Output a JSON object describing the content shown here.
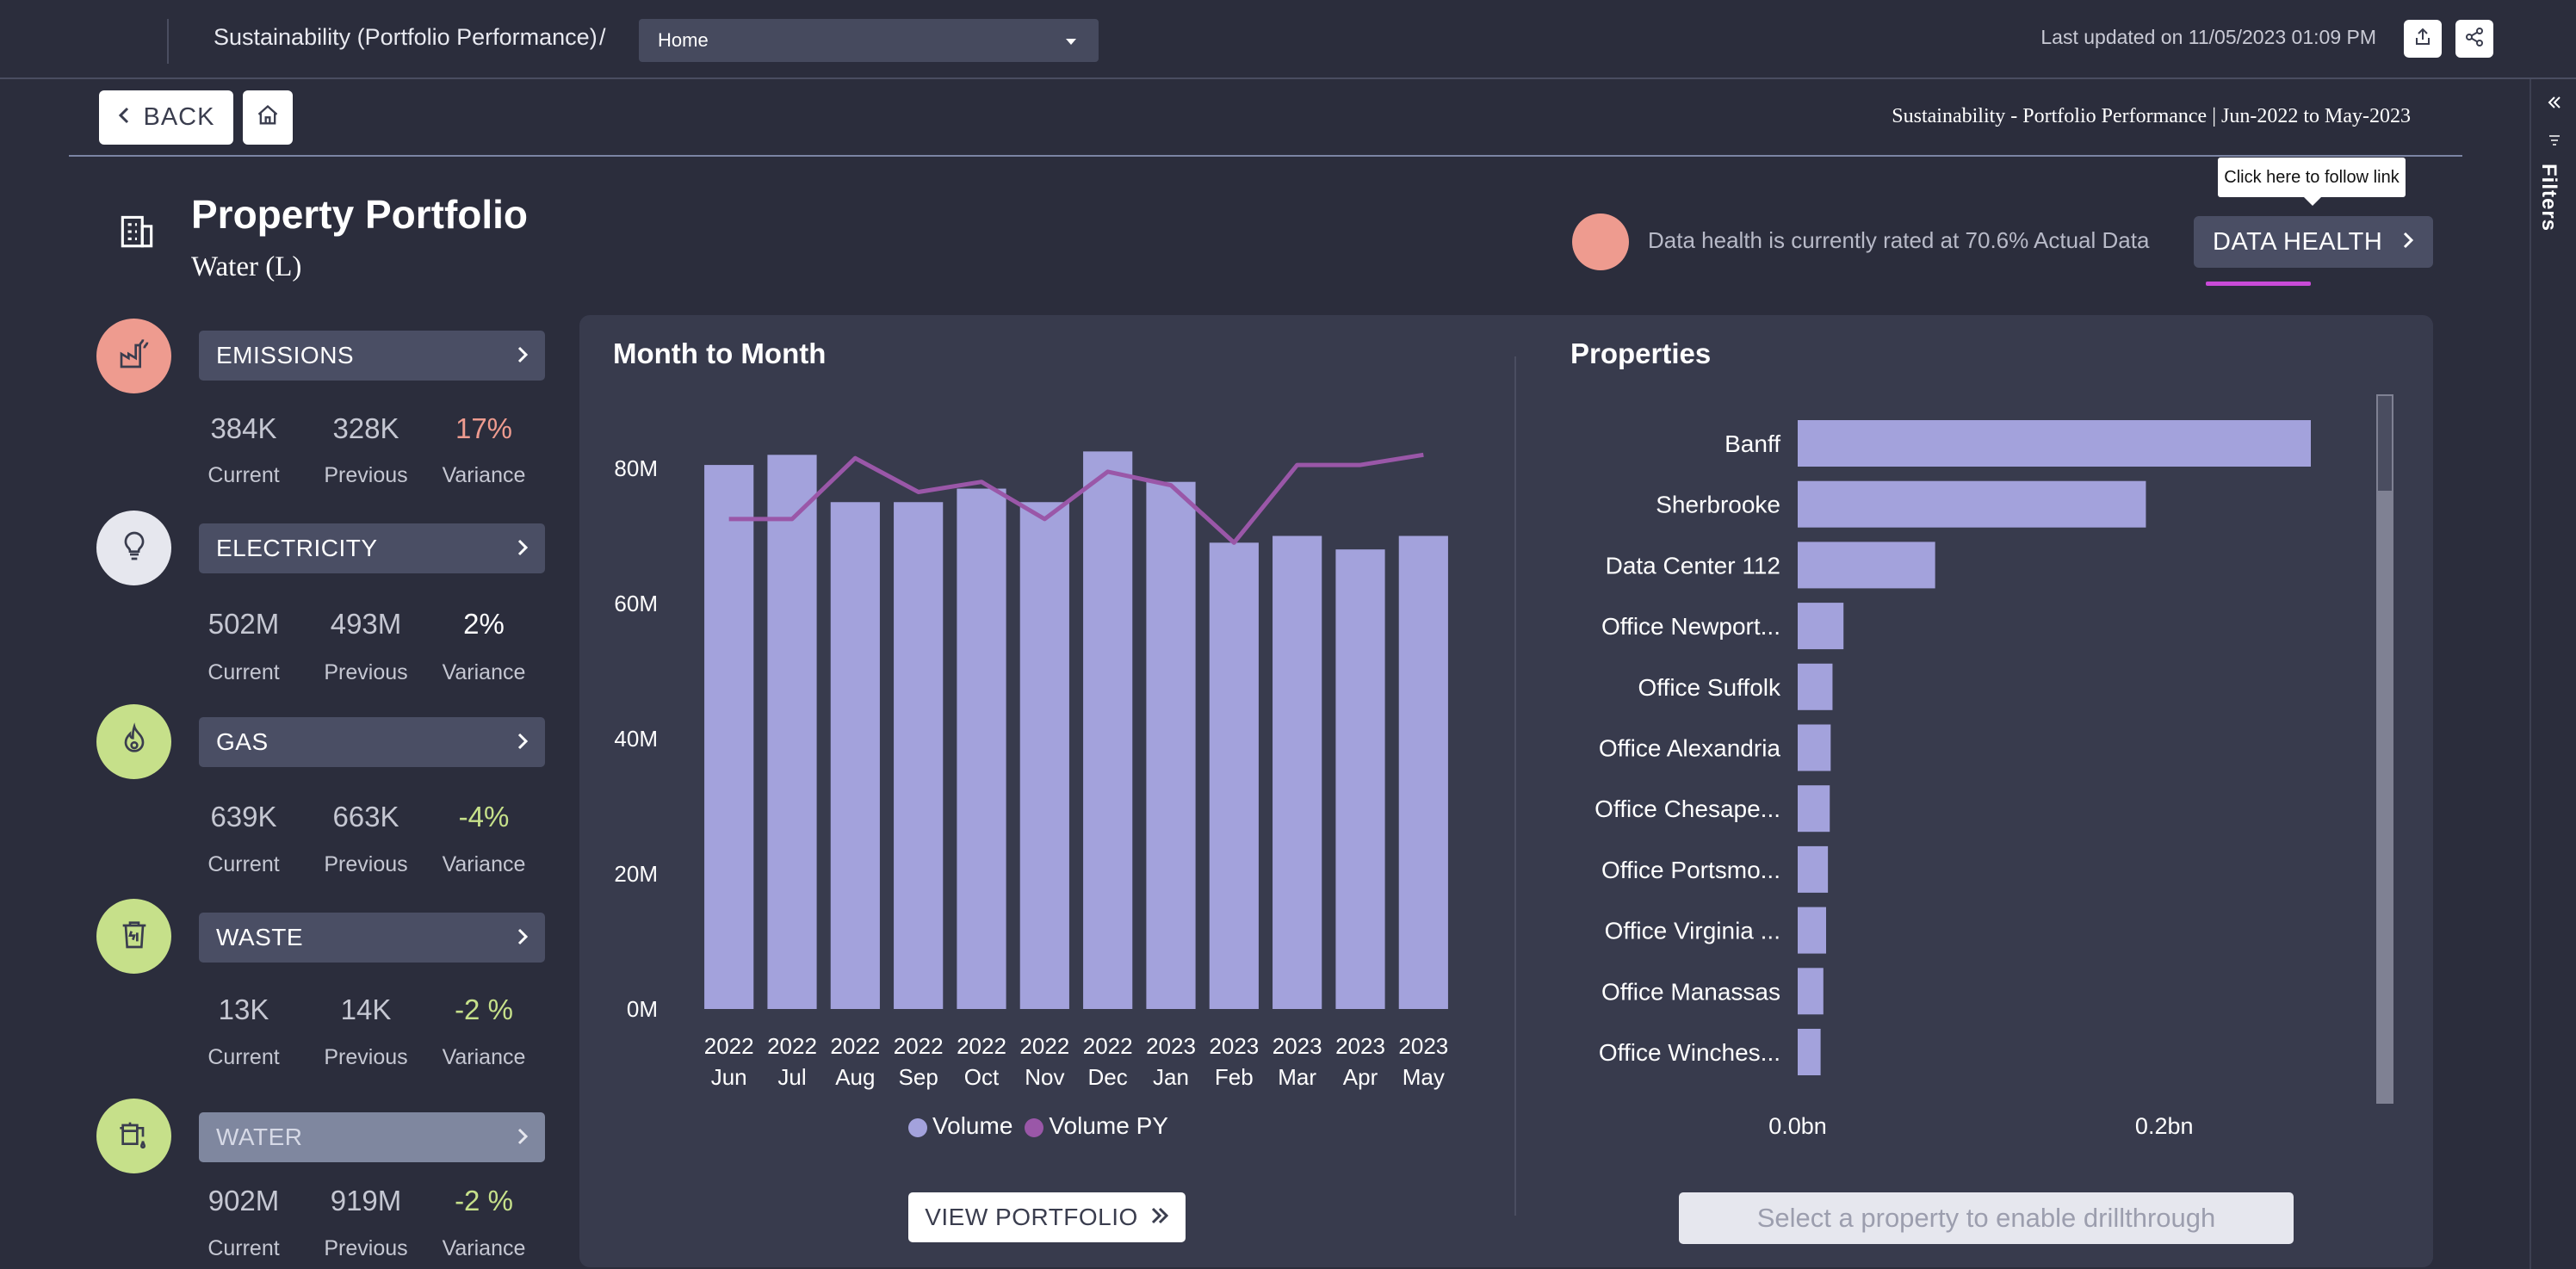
{
  "header": {
    "breadcrumb": "Sustainability (Portfolio Performance)",
    "separator": "/",
    "page_select": "Home",
    "last_updated": "Last updated on 11/05/2023 01:09 PM"
  },
  "toolbar": {
    "back_label": "BACK",
    "report_subtitle": "Sustainability - Portfolio Performance | Jun-2022 to May-2023",
    "filters_label": "Filters"
  },
  "page": {
    "title": "Property Portfolio",
    "subtitle": "Water (L)"
  },
  "data_health": {
    "text": "Data health is currently rated at 70.6% Actual Data",
    "button_label": "DATA HEALTH",
    "tooltip": "Click here to follow link",
    "dot_color": "#ee9b8f"
  },
  "metric_labels": {
    "current": "Current",
    "previous": "Previous",
    "variance": "Variance"
  },
  "metrics": [
    {
      "label": "EMISSIONS",
      "current": "384K",
      "previous": "328K",
      "variance": "17%",
      "variance_color": "#ee9b8f",
      "icon": "factory-icon",
      "circle_color": "#ee9b8f",
      "active": false
    },
    {
      "label": "ELECTRICITY",
      "current": "502M",
      "previous": "493M",
      "variance": "2%",
      "variance_color": "#ffffff",
      "icon": "lightbulb-icon",
      "circle_color": "#e6e7ee",
      "active": false
    },
    {
      "label": "GAS",
      "current": "639K",
      "previous": "663K",
      "variance": "-4%",
      "variance_color": "#c6e08a",
      "icon": "flame-icon",
      "circle_color": "#c6e08a",
      "active": false
    },
    {
      "label": "WASTE",
      "current": "13K",
      "previous": "14K",
      "variance": "-2 %",
      "variance_color": "#c6e08a",
      "icon": "recycle-bin-icon",
      "circle_color": "#c6e08a",
      "active": false
    },
    {
      "label": "WATER",
      "current": "902M",
      "previous": "919M",
      "variance": "-2 %",
      "variance_color": "#c6e08a",
      "icon": "water-tap-icon",
      "circle_color": "#c6e08a",
      "active": true
    }
  ],
  "month_chart": {
    "title": "Month to Month",
    "view_button": "VIEW PORTFOLIO"
  },
  "properties": {
    "title": "Properties",
    "drill_placeholder": "Select a property to enable drillthrough"
  },
  "chart_data": [
    {
      "type": "bar",
      "title": "Month to Month",
      "categories": [
        "2022 Jun",
        "2022 Jul",
        "2022 Aug",
        "2022 Sep",
        "2022 Oct",
        "2022 Nov",
        "2022 Dec",
        "2023 Jan",
        "2023 Feb",
        "2023 Mar",
        "2023 Apr",
        "2023 May"
      ],
      "ylim": [
        0,
        85000000
      ],
      "yticks": [
        0,
        20000000,
        40000000,
        60000000,
        80000000
      ],
      "ytick_labels": [
        "0M",
        "20M",
        "40M",
        "60M",
        "80M"
      ],
      "series": [
        {
          "name": "Volume",
          "kind": "bar",
          "color": "#a3a2dc",
          "values": [
            80500000,
            82000000,
            75000000,
            75000000,
            77000000,
            75000000,
            82500000,
            78000000,
            69000000,
            70000000,
            68000000,
            70000000
          ]
        },
        {
          "name": "Volume PY",
          "kind": "line",
          "color": "#9a57a8",
          "values": [
            72500000,
            72500000,
            81500000,
            76500000,
            78000000,
            72500000,
            79500000,
            77500000,
            69000000,
            80500000,
            80500000,
            82000000
          ]
        }
      ],
      "legend": "bottom"
    },
    {
      "type": "bar",
      "orientation": "horizontal",
      "title": "Properties",
      "categories": [
        "Banff",
        "Sherbrooke",
        "Data Center 112",
        "Office Newport...",
        "Office Suffolk",
        "Office Alexandria",
        "Office Chesape...",
        "Office Portsmo...",
        "Office Virginia ...",
        "Office Manassas",
        "Office Winches..."
      ],
      "values": [
        280000000,
        190000000,
        75000000,
        25000000,
        19000000,
        18000000,
        17500000,
        16500000,
        15500000,
        14000000,
        12500000
      ],
      "xlim": [
        0,
        280000000
      ],
      "xticks": [
        0,
        200000000
      ],
      "xtick_labels": [
        "0.0bn",
        "0.2bn"
      ],
      "color": "#a3a2dc"
    }
  ]
}
